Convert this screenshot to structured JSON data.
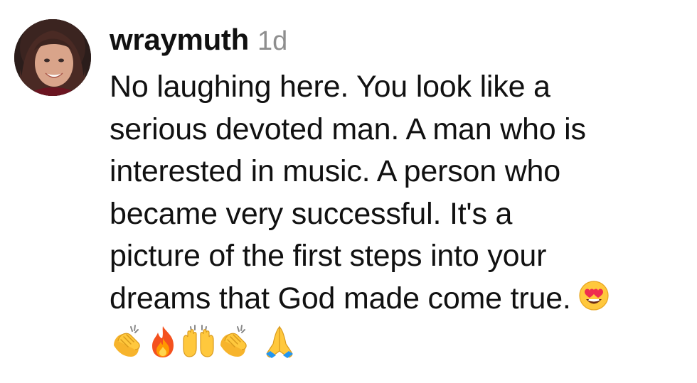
{
  "comment": {
    "username": "wraymuth",
    "timestamp": "1d",
    "avatar_icon": "user-avatar-photo",
    "text_lines": [
      "No laughing here. You look like a",
      "serious devoted man. A man who is",
      "interested in music. A person who",
      "became very successful. It's a",
      "picture of the first steps into your",
      "dreams that God made come true."
    ],
    "inline_emoji": "heart-eyes-emoji",
    "emoji_row": [
      "clapping-hands-emoji",
      "fire-emoji",
      "raising-hands-emoji",
      "clapping-hands-emoji",
      "folded-hands-emoji"
    ]
  }
}
